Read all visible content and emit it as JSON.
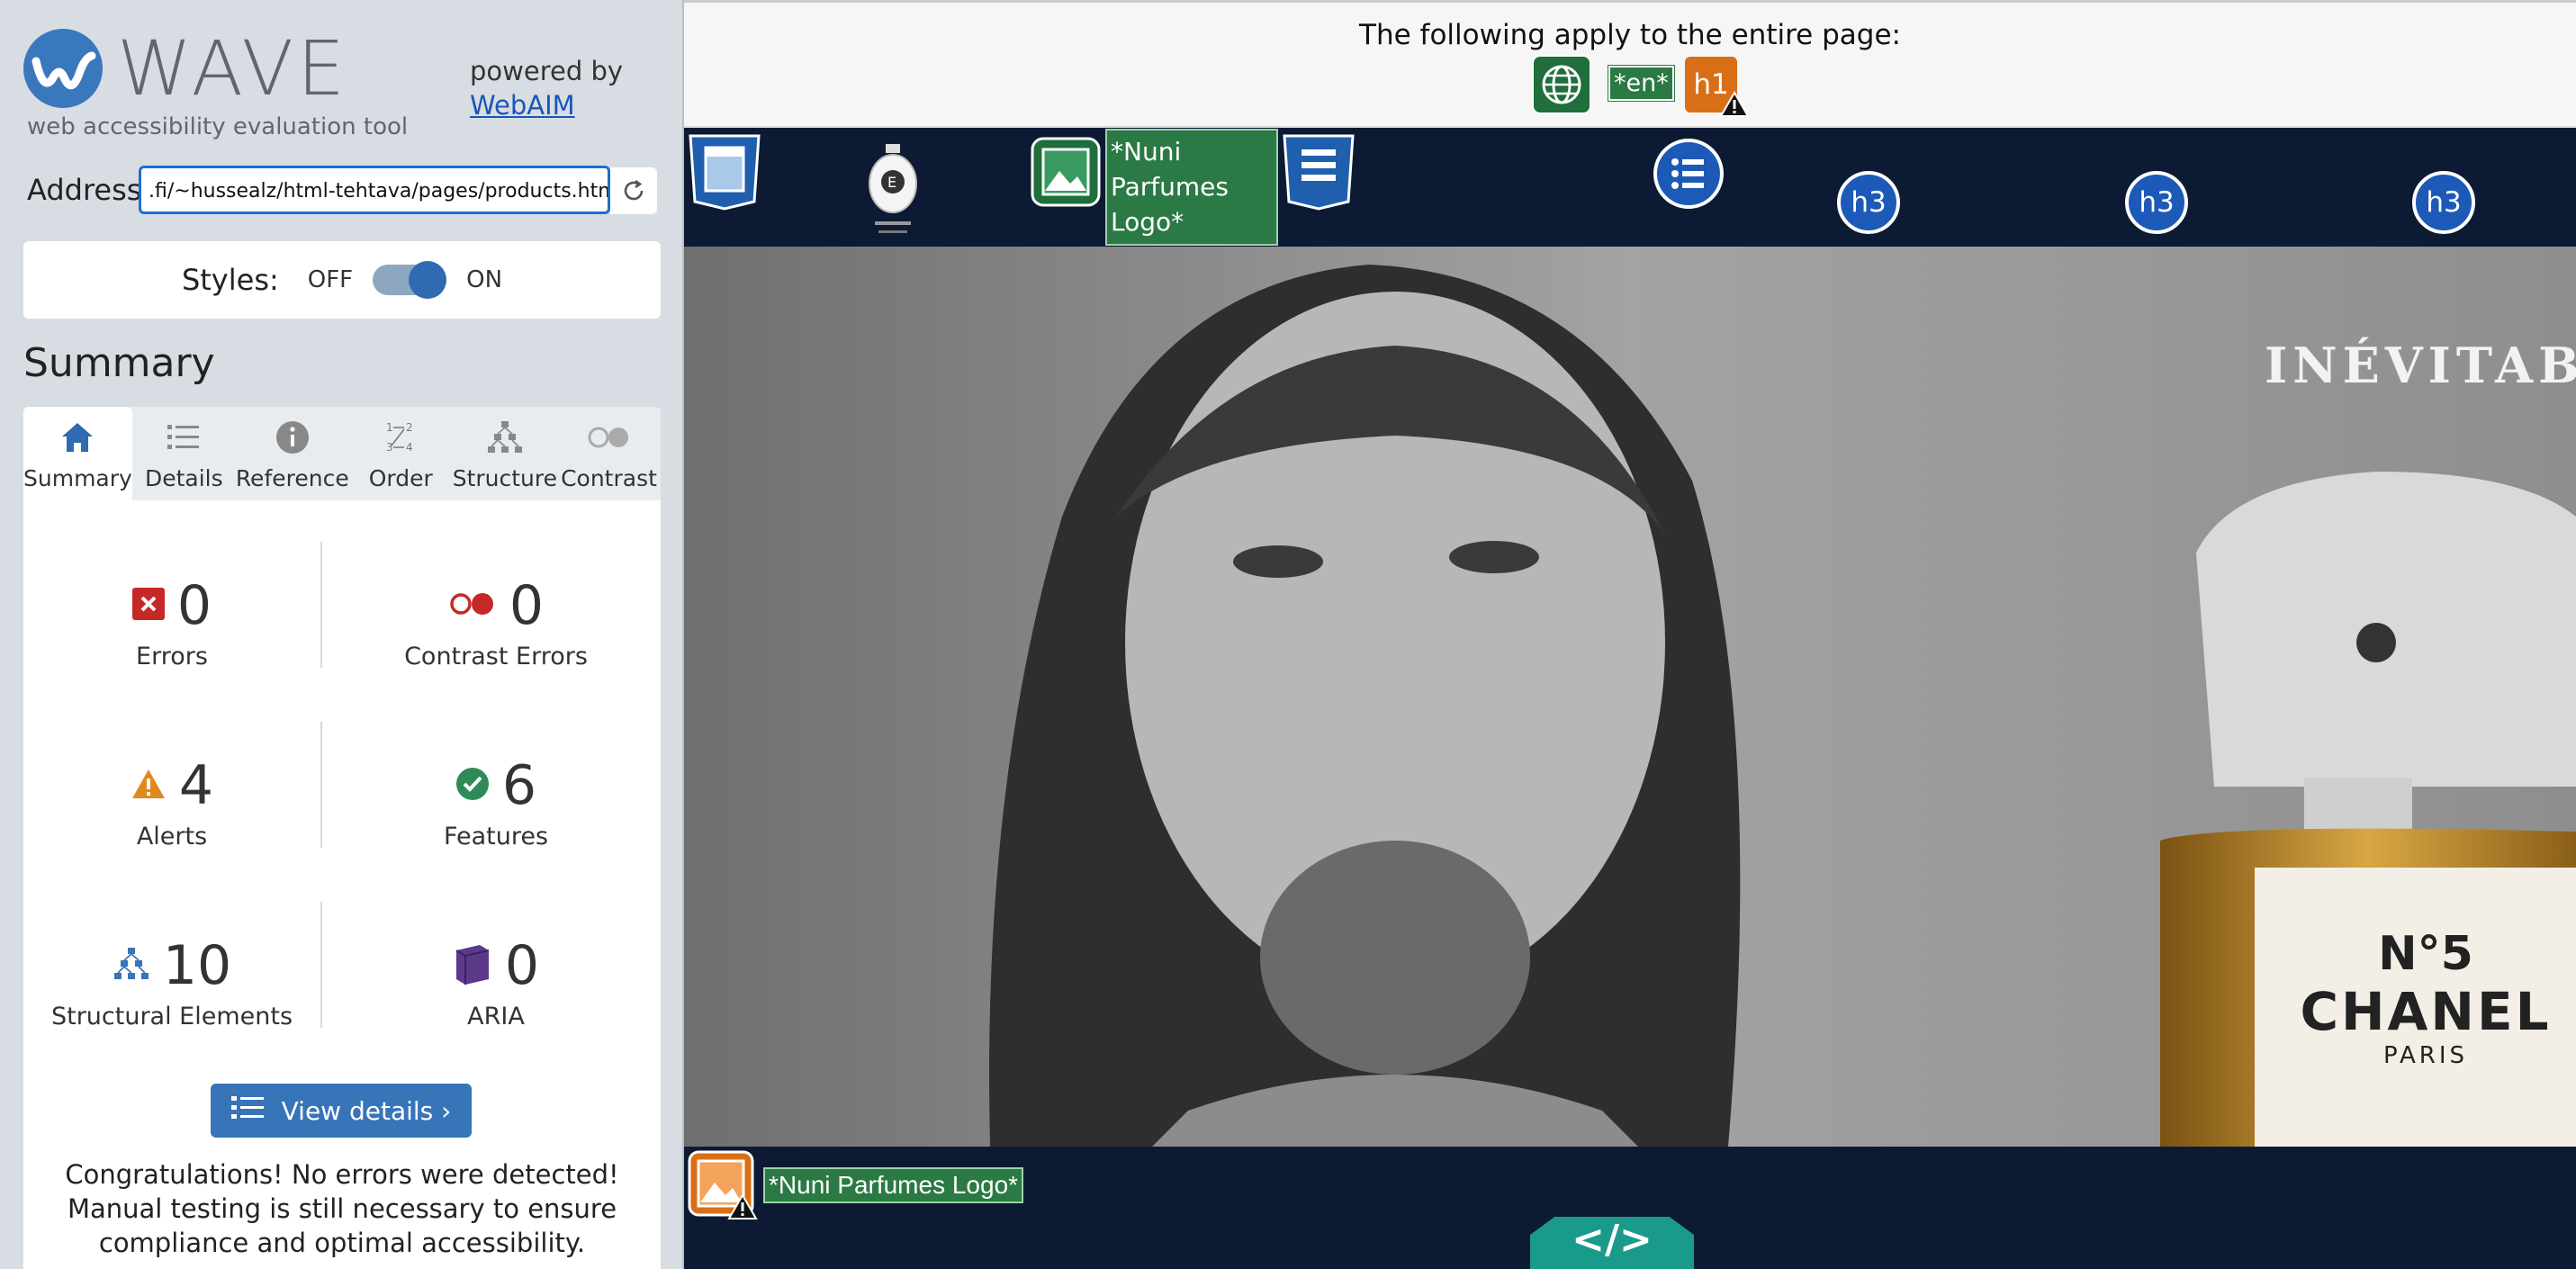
{
  "sidebar": {
    "logo_text": "WAVE",
    "tagline": "web accessibility evaluation tool",
    "powered_by": "powered by",
    "powered_link": "WebAIM",
    "address_label": "Address:",
    "address_value": ".fi/~hussealz/html-tehtava/pages/products.html",
    "styles_label": "Styles:",
    "styles_off": "OFF",
    "styles_on": "ON",
    "summary_heading": "Summary",
    "tabs": [
      {
        "label": "Summary",
        "icon": "home-icon",
        "active": true
      },
      {
        "label": "Details",
        "icon": "list-icon"
      },
      {
        "label": "Reference",
        "icon": "info-icon"
      },
      {
        "label": "Order",
        "icon": "order-icon"
      },
      {
        "label": "Structure",
        "icon": "structure-icon"
      },
      {
        "label": "Contrast",
        "icon": "contrast-icon"
      }
    ],
    "stats": [
      {
        "count": "0",
        "label": "Errors",
        "icon": "error-icon",
        "color": "#c62828"
      },
      {
        "count": "0",
        "label": "Contrast Errors",
        "icon": "contrast-error-icon",
        "color": "#c62828"
      },
      {
        "count": "4",
        "label": "Alerts",
        "icon": "alert-icon",
        "color": "#e08a1e"
      },
      {
        "count": "6",
        "label": "Features",
        "icon": "feature-icon",
        "color": "#2e8b57"
      },
      {
        "count": "10",
        "label": "Structural Elements",
        "icon": "structure-icon",
        "color": "#3874b8"
      },
      {
        "count": "0",
        "label": "ARIA",
        "icon": "aria-icon",
        "color": "#5b3a8c"
      }
    ],
    "view_details": "View details ›",
    "congrats": "Congratulations! No errors were detected! Manual testing is still necessary to ensure compliance and optimal accessibility."
  },
  "preview": {
    "page_note": "The following apply to the entire page:",
    "lang_badge": "*en*",
    "h1_badge": "h1",
    "logo_alt_top": "*Nuni Parfumes Logo*",
    "h3_badges": [
      "h3",
      "h3",
      "h3"
    ],
    "hero_text": "INÉVITABL",
    "bottle_text_1": "N°5",
    "bottle_text_2": "CHANEL",
    "bottle_text_3": "PARIS",
    "logo_alt_bottom": "*Nuni Parfumes Logo*",
    "code_badge": "</>"
  },
  "colors": {
    "accent": "#3874b8",
    "nav_bg": "#0d1a33",
    "feature_green": "#2b7a45",
    "alert_orange": "#d86f16"
  }
}
